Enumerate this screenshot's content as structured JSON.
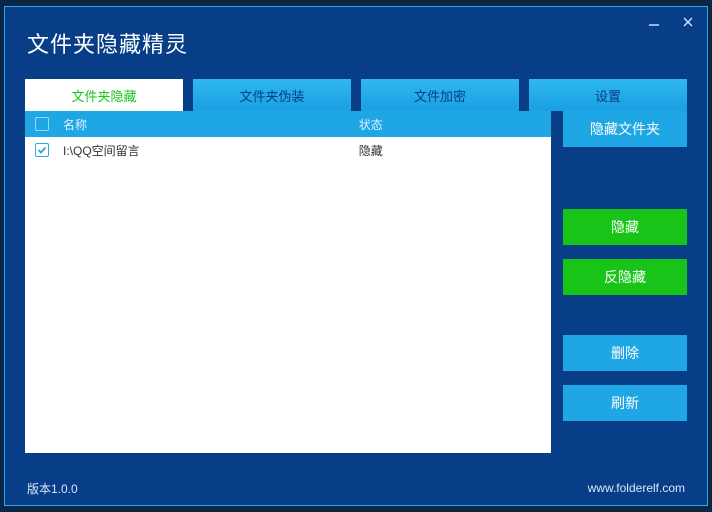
{
  "window": {
    "title": "文件夹隐藏精灵"
  },
  "tabs": {
    "t0": "文件夹隐藏",
    "t1": "文件夹伪装",
    "t2": "文件加密",
    "t3": "设置"
  },
  "listHeader": {
    "name": "名称",
    "status": "状态"
  },
  "rows": [
    {
      "checked": true,
      "name": "I:\\QQ空间留言",
      "status": "隐藏"
    }
  ],
  "sideButtons": {
    "hideFolder": "隐藏文件夹",
    "hide": "隐藏",
    "unhide": "反隐藏",
    "delete": "删除",
    "refresh": "刷新"
  },
  "footer": {
    "version": "版本1.0.0",
    "url": "www.folderelf.com"
  },
  "colors": {
    "windowBg": "#083e87",
    "accentBlue": "#1fa6e4",
    "accentGreen": "#18c418",
    "border": "#2aa8e8"
  }
}
